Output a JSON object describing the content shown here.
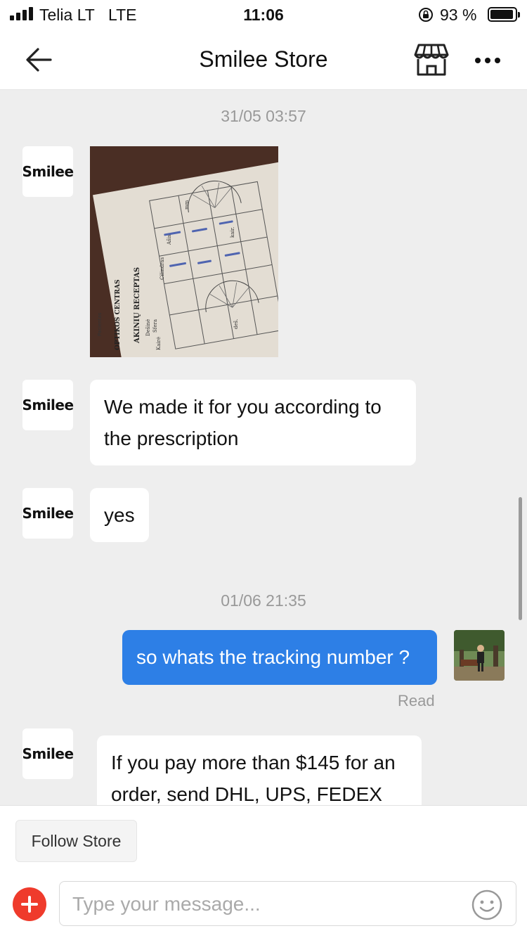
{
  "status_bar": {
    "carrier": "Telia LT",
    "network": "LTE",
    "time": "11:06",
    "battery_percent": "93 %",
    "battery_level": 0.93
  },
  "header": {
    "title": "Smilee Store",
    "back_icon": "back-arrow-icon",
    "store_icon": "storefront-icon",
    "more_icon": "more-dots-icon"
  },
  "chat": {
    "timestamp_1": "31/05 03:57",
    "seller_name": "Smilee",
    "message_2": "We made it for you according to the prescription",
    "message_3": "yes",
    "timestamp_2": "01/06 21:35",
    "message_4": "so whats the tracking number ?",
    "message_4_status": "Read",
    "message_5": "If you pay more than $145 for an order, send DHL, UPS, FEDEX"
  },
  "photo": {
    "brand": "OPTIKOS CENTRAS",
    "title": "AKINIŲ RECEPTAS",
    "labels": [
      "Pacientas",
      "Sfera",
      "Cilindras",
      "Ašis",
      "Dešinė",
      "Kairė",
      "mm",
      "kair.",
      "deš."
    ]
  },
  "bottom": {
    "follow_label": "Follow Store",
    "input_placeholder": "Type your message...",
    "input_value": ""
  },
  "colors": {
    "accent_blue": "#2d7fe6",
    "add_red": "#ef3b2c",
    "background": "#eeeeee"
  }
}
